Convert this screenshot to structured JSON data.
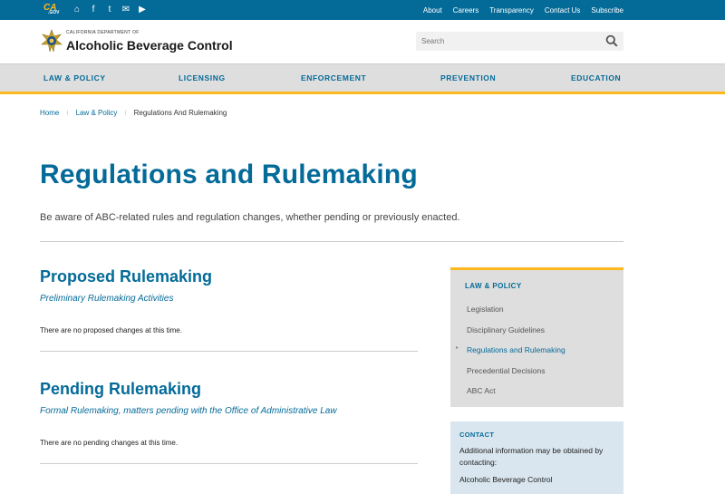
{
  "utility": {
    "ca_logo": "CA",
    "ca_logo_sub": ".GOV",
    "icons": [
      "home-icon",
      "facebook-icon",
      "twitter-icon",
      "email-icon",
      "youtube-icon"
    ],
    "icon_glyphs": [
      "⌂",
      "f",
      "t",
      "✉",
      "▶"
    ],
    "links": [
      "About",
      "Careers",
      "Transparency",
      "Contact Us",
      "Subscribe"
    ]
  },
  "header": {
    "dept_small": "CALIFORNIA DEPARTMENT OF",
    "dept_big": "Alcoholic Beverage Control",
    "search_placeholder": "Search"
  },
  "nav": {
    "items": [
      "LAW & POLICY",
      "LICENSING",
      "ENFORCEMENT",
      "PREVENTION",
      "EDUCATION"
    ]
  },
  "breadcrumb": {
    "home": "Home",
    "section": "Law & Policy",
    "current": "Regulations And Rulemaking",
    "separator": "⁝"
  },
  "page": {
    "title": "Regulations and Rulemaking",
    "lede": "Be aware of ABC-related rules and regulation changes, whether pending or previously enacted."
  },
  "sections": [
    {
      "heading": "Proposed Rulemaking",
      "subheading": "Preliminary Rulemaking Activities",
      "body": "There are no proposed changes at this time."
    },
    {
      "heading": "Pending Rulemaking",
      "subheading": "Formal Rulemaking, matters pending with the Office of Administrative Law",
      "body": "There are no pending changes at this time."
    }
  ],
  "sidenav": {
    "title": "LAW & POLICY",
    "items": [
      "Legislation",
      "Disciplinary Guidelines",
      "Regulations and Rulemaking",
      "Precedential Decisions",
      "ABC Act"
    ],
    "active_index": 2,
    "active_marker": "▸"
  },
  "contact": {
    "title": "CONTACT",
    "text": "Additional information may be obtained by contacting:",
    "org": "Alcoholic Beverage Control"
  },
  "colors": {
    "primary": "#046b99",
    "accent": "#fdb81e",
    "nav_bg": "#dedede",
    "contact_bg": "#d9e6ef"
  }
}
